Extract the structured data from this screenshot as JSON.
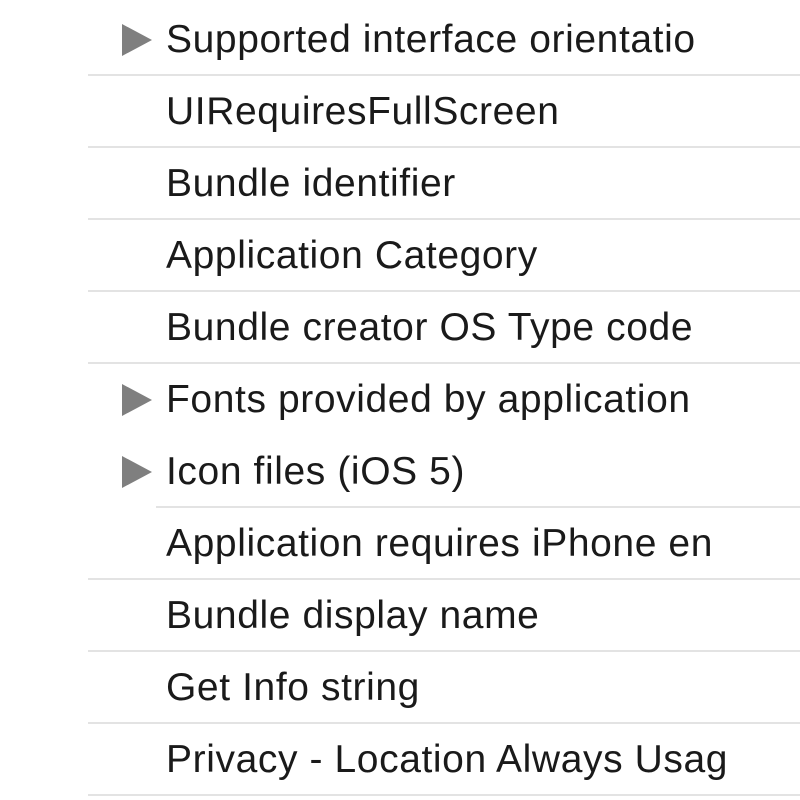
{
  "rows": [
    {
      "label": "Supported interface orientatio",
      "expandable": true
    },
    {
      "label": "UIRequiresFullScreen",
      "expandable": false
    },
    {
      "label": "Bundle identifier",
      "expandable": false
    },
    {
      "label": "Application Category",
      "expandable": false
    },
    {
      "label": "Bundle creator OS Type code",
      "expandable": false
    },
    {
      "label": "Fonts provided by application",
      "expandable": true
    },
    {
      "label": "Icon files (iOS 5)",
      "expandable": true
    },
    {
      "label": "Application requires iPhone en",
      "expandable": false
    },
    {
      "label": "Bundle display name",
      "expandable": false
    },
    {
      "label": "Get Info string",
      "expandable": false
    },
    {
      "label": "Privacy - Location Always Usag",
      "expandable": false
    }
  ]
}
